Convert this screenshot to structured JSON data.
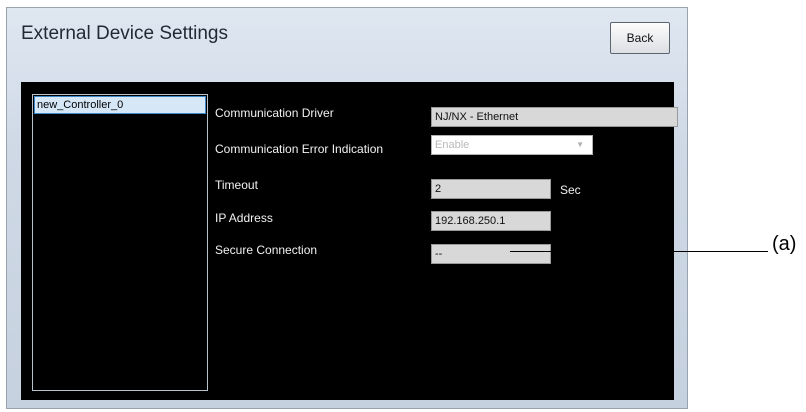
{
  "window": {
    "title": "External Device Settings",
    "back_label": "Back"
  },
  "device_list": {
    "items": [
      {
        "label": "new_Controller_0",
        "selected": true
      }
    ]
  },
  "settings": {
    "communication_driver": {
      "label": "Communication Driver",
      "value": "NJ/NX - Ethernet"
    },
    "error_indication": {
      "label": "Communication Error Indication",
      "value": "Enable"
    },
    "timeout": {
      "label": "Timeout",
      "value": "2",
      "unit": "Sec"
    },
    "ip_address": {
      "label": "IP Address",
      "value": "192.168.250.1"
    },
    "secure_connection": {
      "label": "Secure Connection",
      "value": "--"
    }
  },
  "annotation": {
    "label": "(a)"
  },
  "colors": {
    "panel_background": "#000000",
    "selection_fill": "#d6e8f8",
    "selection_border": "#3d88c9"
  }
}
